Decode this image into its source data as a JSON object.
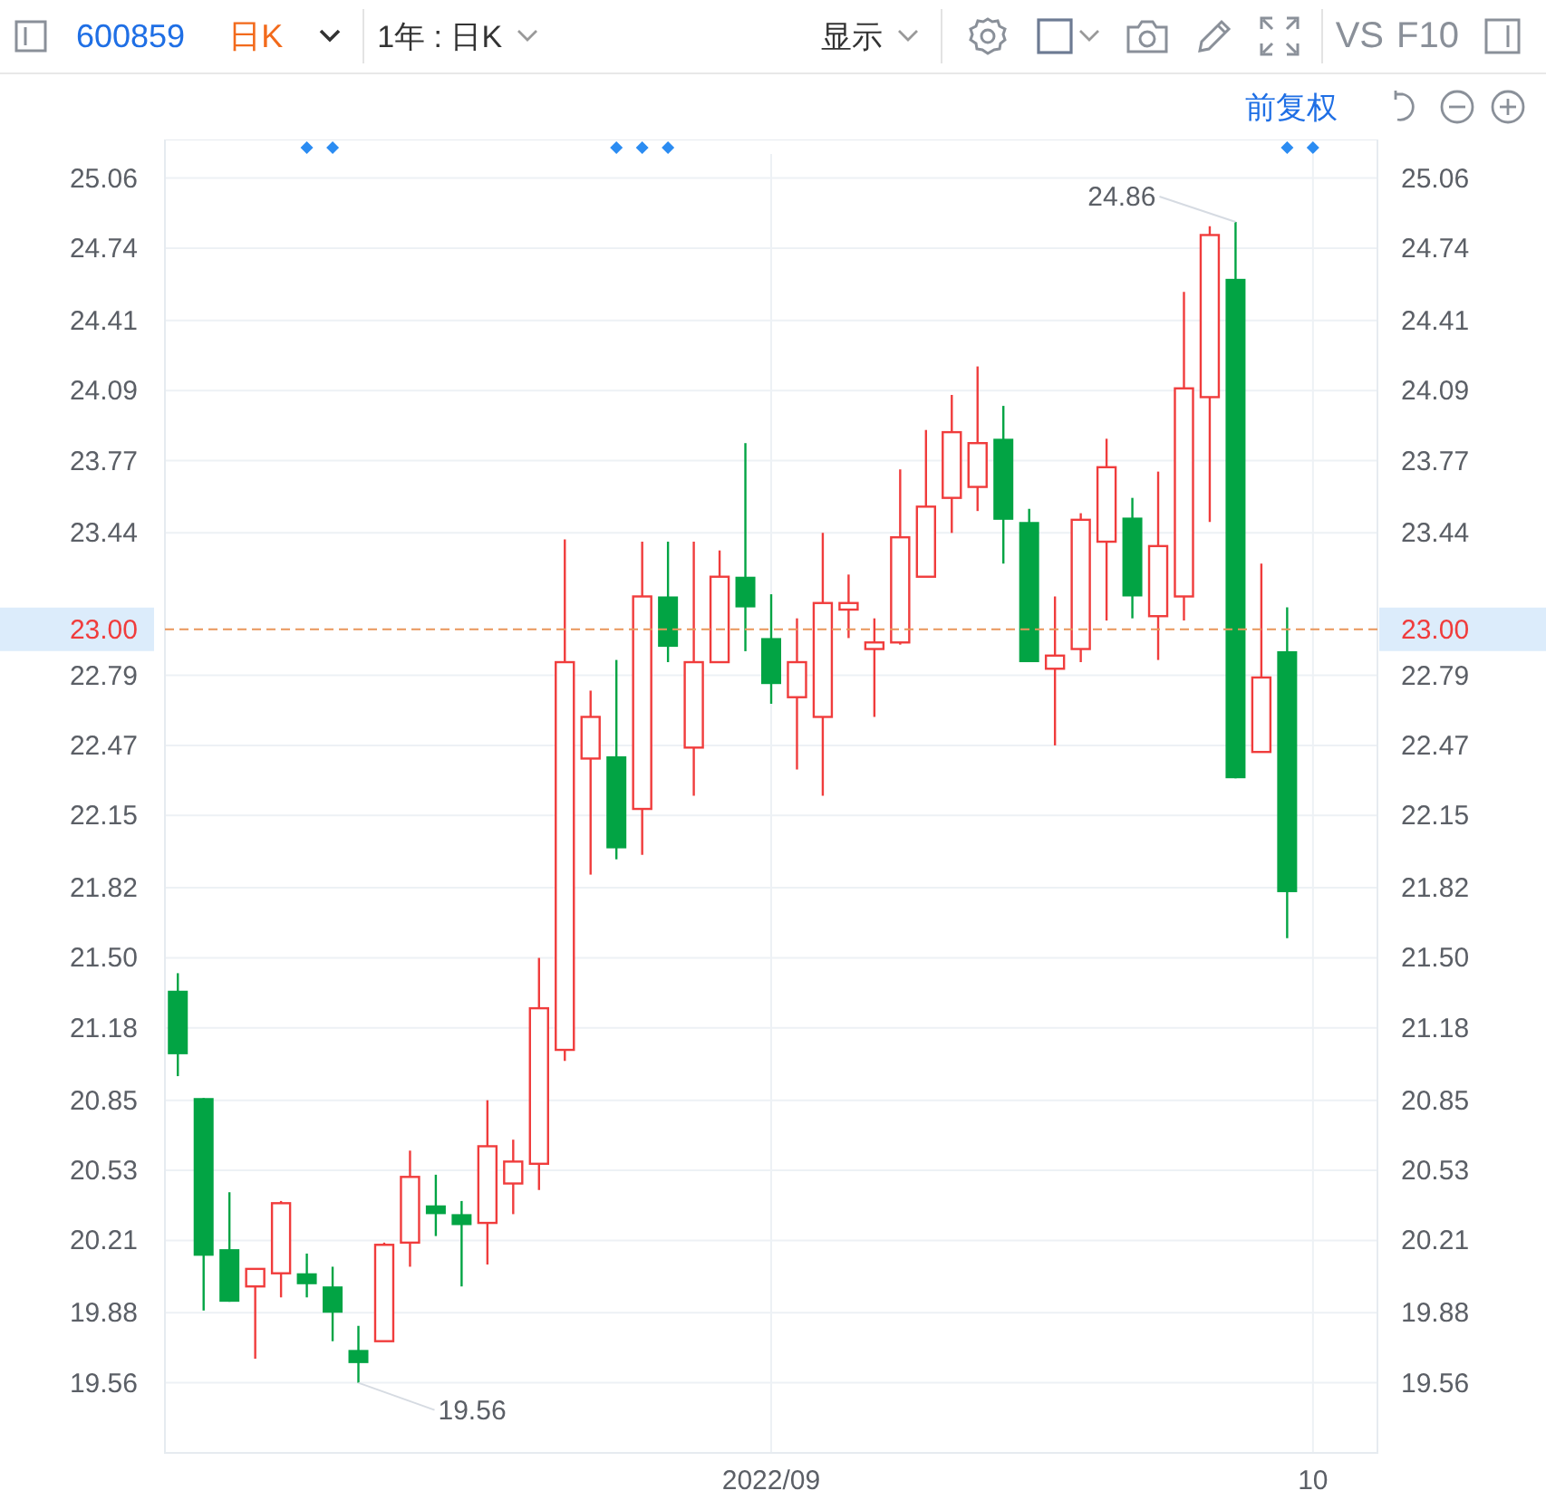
{
  "toolbar": {
    "code": "600859",
    "period": "日K",
    "range": "1年 : 日K",
    "display": "显示",
    "vs": "VS",
    "f10": "F10"
  },
  "subbar": {
    "adjust": "前复权"
  },
  "chart": {
    "chart_data": {
      "type": "candlestick",
      "grid": true,
      "categories": [
        null,
        null,
        null,
        null,
        null,
        null,
        null,
        null,
        null,
        null,
        null,
        null,
        null,
        null,
        null,
        null,
        null,
        null,
        null,
        null,
        null,
        null,
        null,
        "2022/09",
        null,
        null,
        null,
        null,
        null,
        null,
        null,
        null,
        null,
        null,
        null,
        null,
        null,
        null,
        null,
        null,
        null,
        null,
        null,
        null,
        "10",
        null,
        null
      ],
      "ylim": [
        19.24,
        25.17
      ],
      "yticks": [
        25.06,
        24.74,
        24.41,
        24.09,
        23.77,
        23.44,
        22.79,
        22.47,
        22.15,
        21.82,
        {
          "value": 21.5,
          "label": "21.50"
        },
        21.18,
        20.85,
        20.53,
        20.21,
        19.88,
        19.56
      ],
      "ohlc": [
        [
          21.35,
          21.43,
          20.96,
          21.06
        ],
        [
          20.86,
          20.86,
          19.89,
          20.14
        ],
        [
          20.17,
          20.43,
          19.93,
          19.93
        ],
        [
          20.0,
          20.08,
          19.67,
          20.08
        ],
        [
          20.06,
          20.39,
          19.95,
          20.38
        ],
        [
          20.06,
          20.15,
          19.95,
          20.01
        ],
        [
          20.0,
          20.09,
          19.75,
          19.88
        ],
        [
          19.71,
          19.82,
          19.56,
          19.65
        ],
        [
          19.75,
          20.2,
          19.75,
          20.19
        ],
        [
          20.2,
          20.62,
          20.09,
          20.5
        ],
        [
          20.37,
          20.51,
          20.23,
          20.33
        ],
        [
          20.33,
          20.39,
          20.0,
          20.28
        ],
        [
          20.29,
          20.85,
          20.1,
          20.64
        ],
        [
          20.47,
          20.67,
          20.33,
          20.57
        ],
        [
          20.56,
          21.5,
          20.44,
          21.27
        ],
        [
          21.08,
          23.41,
          21.03,
          22.85
        ],
        [
          22.41,
          22.72,
          21.88,
          22.6
        ],
        [
          22.42,
          22.86,
          21.95,
          22.0
        ],
        [
          22.18,
          23.4,
          21.97,
          23.15
        ],
        [
          23.15,
          23.4,
          22.85,
          22.92
        ],
        [
          22.46,
          23.4,
          22.24,
          22.85
        ],
        [
          22.85,
          23.36,
          22.85,
          23.24
        ],
        [
          23.24,
          23.85,
          22.9,
          23.1
        ],
        [
          22.96,
          23.16,
          22.66,
          22.75
        ],
        [
          22.69,
          23.05,
          22.36,
          22.85
        ],
        [
          22.6,
          23.44,
          22.24,
          23.12
        ],
        [
          23.09,
          23.25,
          22.96,
          23.12
        ],
        [
          22.91,
          23.05,
          22.6,
          22.94
        ],
        [
          22.94,
          23.73,
          22.93,
          23.42
        ],
        [
          23.24,
          23.91,
          23.24,
          23.56
        ],
        [
          23.6,
          24.07,
          23.44,
          23.9
        ],
        [
          23.65,
          24.2,
          23.54,
          23.85
        ],
        [
          23.87,
          24.02,
          23.3,
          23.5
        ],
        [
          23.49,
          23.55,
          22.85,
          22.85
        ],
        [
          22.82,
          23.15,
          22.47,
          22.88
        ],
        [
          22.91,
          23.53,
          22.85,
          23.5
        ],
        [
          23.4,
          23.87,
          23.04,
          23.74
        ],
        [
          23.51,
          23.6,
          23.05,
          23.15
        ],
        [
          23.06,
          23.72,
          22.86,
          23.38
        ],
        [
          23.15,
          24.54,
          23.04,
          24.1
        ],
        [
          24.06,
          24.84,
          23.49,
          24.8
        ],
        [
          24.6,
          24.86,
          22.32,
          22.32
        ],
        [
          22.44,
          23.3,
          22.44,
          22.78
        ],
        [
          22.9,
          23.1,
          21.59,
          21.8
        ],
        null,
        null,
        null
      ],
      "ref_lines": [
        {
          "axis": "y",
          "value": 23.0,
          "label": "23.00"
        }
      ],
      "annotations": [
        "24.86",
        "19.56"
      ]
    },
    "right_axis_labels": [
      "25.06",
      "24.74",
      "24.41",
      "24.09",
      "23.77",
      "23.44",
      "22.79",
      "22.47",
      "22.15",
      "21.82",
      "21.50",
      "21.18",
      "20.85",
      "20.53",
      "20.21",
      "19.88",
      "19.56"
    ],
    "right_price_label": "23.00"
  }
}
